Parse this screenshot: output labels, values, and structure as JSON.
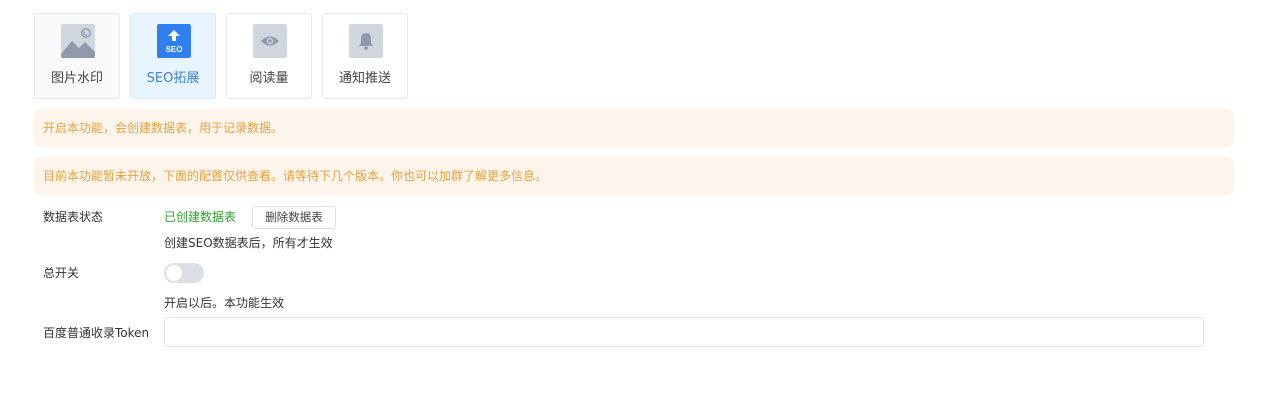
{
  "tabs": [
    {
      "label": "图片水印",
      "icon": "image-watermark-icon",
      "active": false
    },
    {
      "label": "SEO拓展",
      "icon": "seo-upload-icon",
      "icon_text": "SEO",
      "active": true
    },
    {
      "label": "阅读量",
      "icon": "eye-icon",
      "active": false
    },
    {
      "label": "通知推送",
      "icon": "bell-icon",
      "active": false
    }
  ],
  "alerts": {
    "create_table": "开启本功能，会创建数据表，用于记录数据。",
    "not_open": "目前本功能暂未开放，下面的配置仅供查看。请等待下几个版本。你也可以加群了解更多信息。"
  },
  "form": {
    "table_status": {
      "label": "数据表状态",
      "value": "已创建数据表",
      "delete_button": "删除数据表",
      "help": "创建SEO数据表后，所有才生效"
    },
    "master_switch": {
      "label": "总开关",
      "enabled": false,
      "help": "开启以后。本功能生效"
    },
    "baidu_token": {
      "label": "百度普通收录Token",
      "value": "",
      "placeholder": ""
    }
  },
  "colors": {
    "accent": "#3d82d6",
    "warning_text": "#e6a23c",
    "warning_bg": "#fdf5ec",
    "success_text": "#2f9e2f",
    "switch_off": "#dcdfe6"
  }
}
